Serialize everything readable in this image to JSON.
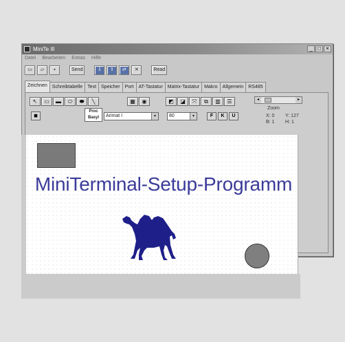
{
  "window": {
    "title": "MiniTe Ill",
    "controls": [
      "_",
      "□",
      "×"
    ]
  },
  "menu": [
    "Datei",
    "Bearbeiten",
    "Extras",
    "Hilfe"
  ],
  "toolbar": {
    "buttons": [
      "",
      "",
      "",
      "",
      "Send",
      "",
      "",
      "",
      "",
      "",
      "Read"
    ]
  },
  "tabs": [
    "Zeichnen",
    "Schreibtabelle",
    "Text",
    "Speicher",
    "Port",
    "AT-Tastatur",
    "Matrix-Tastatur",
    "Makro",
    "Allgemein",
    "RS485"
  ],
  "panel": {
    "zoom_label": "Zoom",
    "coords": {
      "x": "X: 0",
      "y": "Y: 127",
      "b": "B: 1",
      "h": "H: 1"
    },
    "font_box": "Proc\nBasyl",
    "font_select": "Arimat I",
    "size_select": "80",
    "format_buttons": [
      "F",
      "K",
      "U"
    ]
  },
  "canvas": {
    "title": "MiniTerminal-Setup-Programm"
  }
}
